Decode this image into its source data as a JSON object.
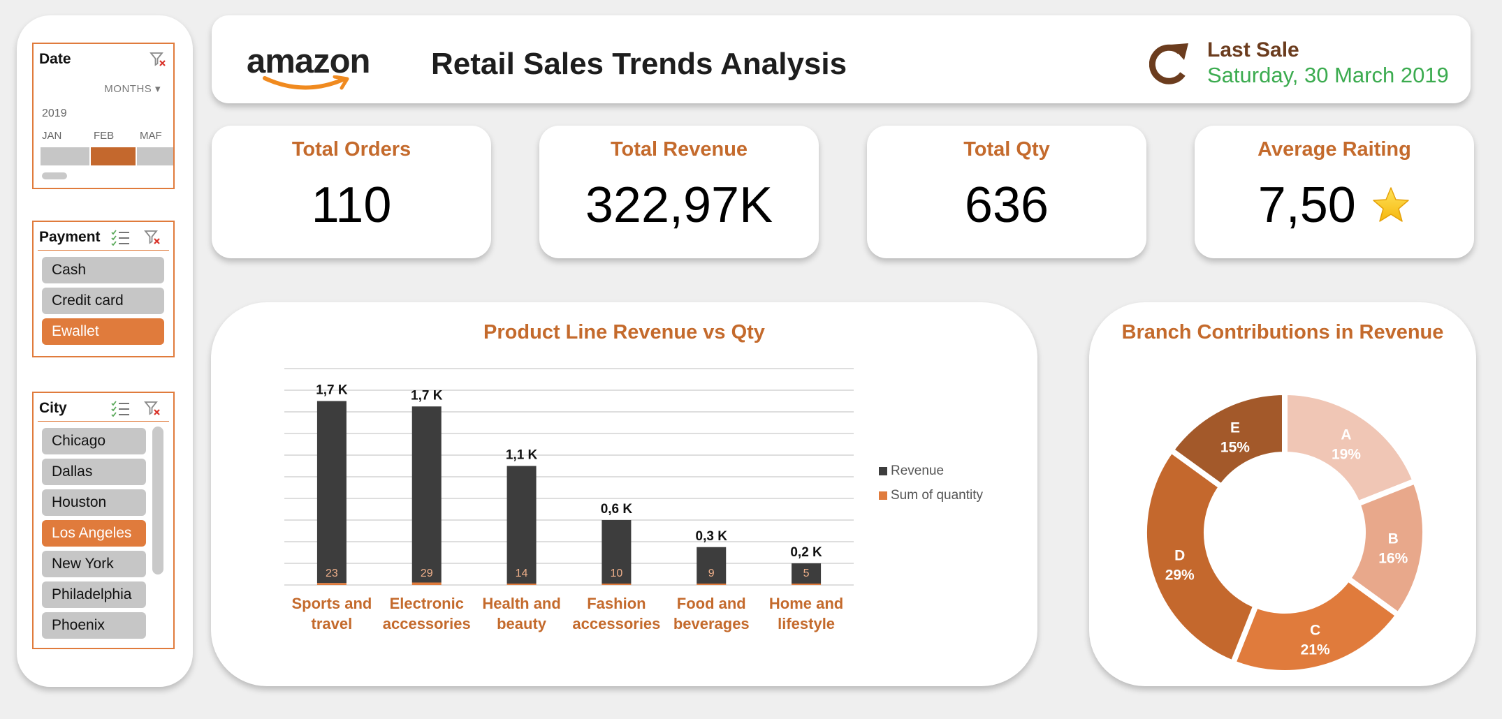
{
  "filters": {
    "date": {
      "title": "Date",
      "level": "MONTHS",
      "year": "2019",
      "months": [
        {
          "label": "JAN",
          "selected": false
        },
        {
          "label": "FEB",
          "selected": true
        },
        {
          "label": "MAF",
          "selected": false
        }
      ]
    },
    "payment": {
      "title": "Payment",
      "items": [
        {
          "label": "Cash",
          "selected": false
        },
        {
          "label": "Credit card",
          "selected": false
        },
        {
          "label": "Ewallet",
          "selected": true
        }
      ]
    },
    "city": {
      "title": "City",
      "items": [
        {
          "label": "Chicago",
          "selected": false
        },
        {
          "label": "Dallas",
          "selected": false
        },
        {
          "label": "Houston",
          "selected": false
        },
        {
          "label": "Los Angeles",
          "selected": true
        },
        {
          "label": "New York",
          "selected": false
        },
        {
          "label": "Philadelphia",
          "selected": false
        },
        {
          "label": "Phoenix",
          "selected": false
        }
      ]
    }
  },
  "header": {
    "logo_text": "amazon",
    "title": "Retail Sales Trends Analysis",
    "last_sale_label": "Last Sale",
    "last_sale_date": "Saturday, 30 March 2019"
  },
  "kpis": {
    "orders": {
      "label": "Total Orders",
      "value": "110"
    },
    "revenue": {
      "label": "Total Revenue",
      "value": "322,97K"
    },
    "qty": {
      "label": "Total Qty",
      "value": "636"
    },
    "rating": {
      "label": "Average Raiting",
      "value": "7,50",
      "icon": "star-icon"
    }
  },
  "colors": {
    "accent": "#c46a2c",
    "slicer_selected": "#e07b3c",
    "revenue_bar": "#3d3d3d",
    "qty_bar": "#e07b3c",
    "last_sale_date": "#3bab4f"
  },
  "chart_data": [
    {
      "type": "bar",
      "title": "Product Line Revenue vs Qty",
      "categories": [
        "Sports and travel",
        "Electronic accessories",
        "Health and beauty",
        "Fashion accessories",
        "Food and beverages",
        "Home and lifestyle"
      ],
      "series": [
        {
          "name": "Revenue",
          "values": [
            1700,
            1650,
            1100,
            600,
            350,
            200
          ],
          "labels": [
            "1,7 K",
            "1,7 K",
            "1,1 K",
            "0,6 K",
            "0,3 K",
            "0,2 K"
          ]
        },
        {
          "name": "Sum of quantity",
          "values": [
            23,
            29,
            14,
            10,
            9,
            5
          ]
        }
      ],
      "ylim": [
        0,
        2000
      ],
      "grid": true,
      "legend": "right",
      "stacked": true
    },
    {
      "type": "pie",
      "title": "Branch Contributions in Revenue",
      "categories": [
        "A",
        "B",
        "C",
        "D",
        "E"
      ],
      "values": [
        19,
        16,
        21,
        29,
        15
      ],
      "labels": [
        "19%",
        "16%",
        "21%",
        "29%",
        "15%"
      ],
      "colors": [
        "#f0c6b5",
        "#e8a88b",
        "#e07b3c",
        "#c4682d",
        "#a3592a"
      ],
      "donut": true
    }
  ]
}
